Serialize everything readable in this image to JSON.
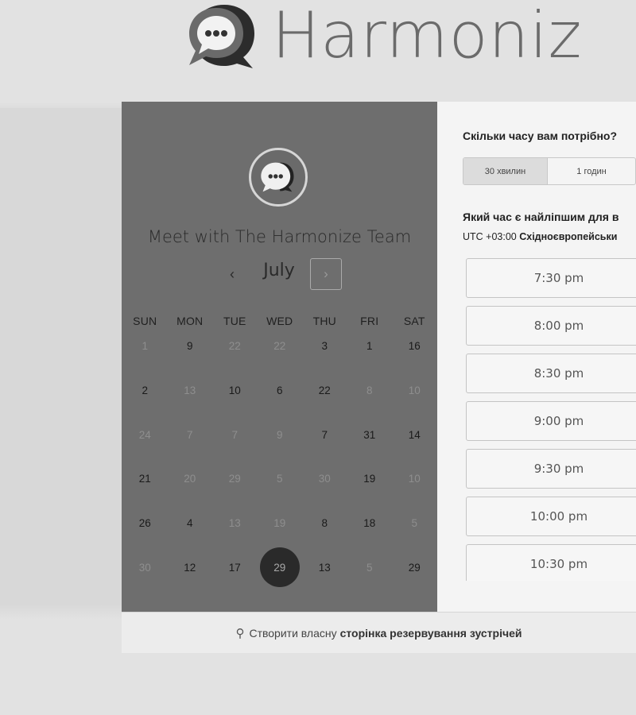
{
  "brand": {
    "name": "Harmoniz",
    "logo_icon": "chat-bubble-logo-icon"
  },
  "scheduler": {
    "title": "Meet with The Harmonize Team",
    "month": "July",
    "prev_icon": "‹",
    "next_icon": "›",
    "weekdays": [
      "SUN",
      "MON",
      "TUE",
      "WED",
      "THU",
      "FRI",
      "SAT"
    ],
    "weeks": [
      [
        {
          "d": "1",
          "a": false
        },
        {
          "d": "9",
          "a": true
        },
        {
          "d": "22",
          "a": false
        },
        {
          "d": "22",
          "a": false
        },
        {
          "d": "3",
          "a": true
        },
        {
          "d": "1",
          "a": true
        },
        {
          "d": "16",
          "a": true
        }
      ],
      [
        {
          "d": "2",
          "a": true
        },
        {
          "d": "13",
          "a": false
        },
        {
          "d": "10",
          "a": true
        },
        {
          "d": "6",
          "a": true
        },
        {
          "d": "22",
          "a": true
        },
        {
          "d": "8",
          "a": false
        },
        {
          "d": "10",
          "a": false
        }
      ],
      [
        {
          "d": "24",
          "a": false
        },
        {
          "d": "7",
          "a": false
        },
        {
          "d": "7",
          "a": false
        },
        {
          "d": "9",
          "a": false
        },
        {
          "d": "7",
          "a": true
        },
        {
          "d": "31",
          "a": true
        },
        {
          "d": "14",
          "a": true
        }
      ],
      [
        {
          "d": "21",
          "a": true
        },
        {
          "d": "20",
          "a": false
        },
        {
          "d": "29",
          "a": false
        },
        {
          "d": "5",
          "a": false
        },
        {
          "d": "30",
          "a": false
        },
        {
          "d": "19",
          "a": true
        },
        {
          "d": "10",
          "a": false
        }
      ],
      [
        {
          "d": "26",
          "a": true
        },
        {
          "d": "4",
          "a": true
        },
        {
          "d": "13",
          "a": false
        },
        {
          "d": "19",
          "a": false
        },
        {
          "d": "8",
          "a": true
        },
        {
          "d": "18",
          "a": true
        },
        {
          "d": "5",
          "a": false
        }
      ],
      [
        {
          "d": "30",
          "a": false
        },
        {
          "d": "12",
          "a": true
        },
        {
          "d": "17",
          "a": true
        },
        {
          "d": "29",
          "a": true,
          "selected": true
        },
        {
          "d": "13",
          "a": true
        },
        {
          "d": "5",
          "a": false
        },
        {
          "d": "29",
          "a": true
        }
      ]
    ]
  },
  "duration": {
    "question": "Скільки часу вам потрібно?",
    "options": [
      "30 хвилин",
      "1 годин"
    ],
    "selected": "30 хвилин"
  },
  "time_select": {
    "question": "Який час є найліпшим для в",
    "tz_offset": "UTC +03:00",
    "tz_name": "Східноєвропейськи",
    "slots": [
      "7:30 pm",
      "8:00 pm",
      "8:30 pm",
      "9:00 pm",
      "9:30 pm",
      "10:00 pm",
      "10:30 pm"
    ]
  },
  "footer": {
    "icon": "hubspot-sprocket-icon",
    "prefix": "Створити власну",
    "link": "сторінка резервування зустрічей"
  }
}
